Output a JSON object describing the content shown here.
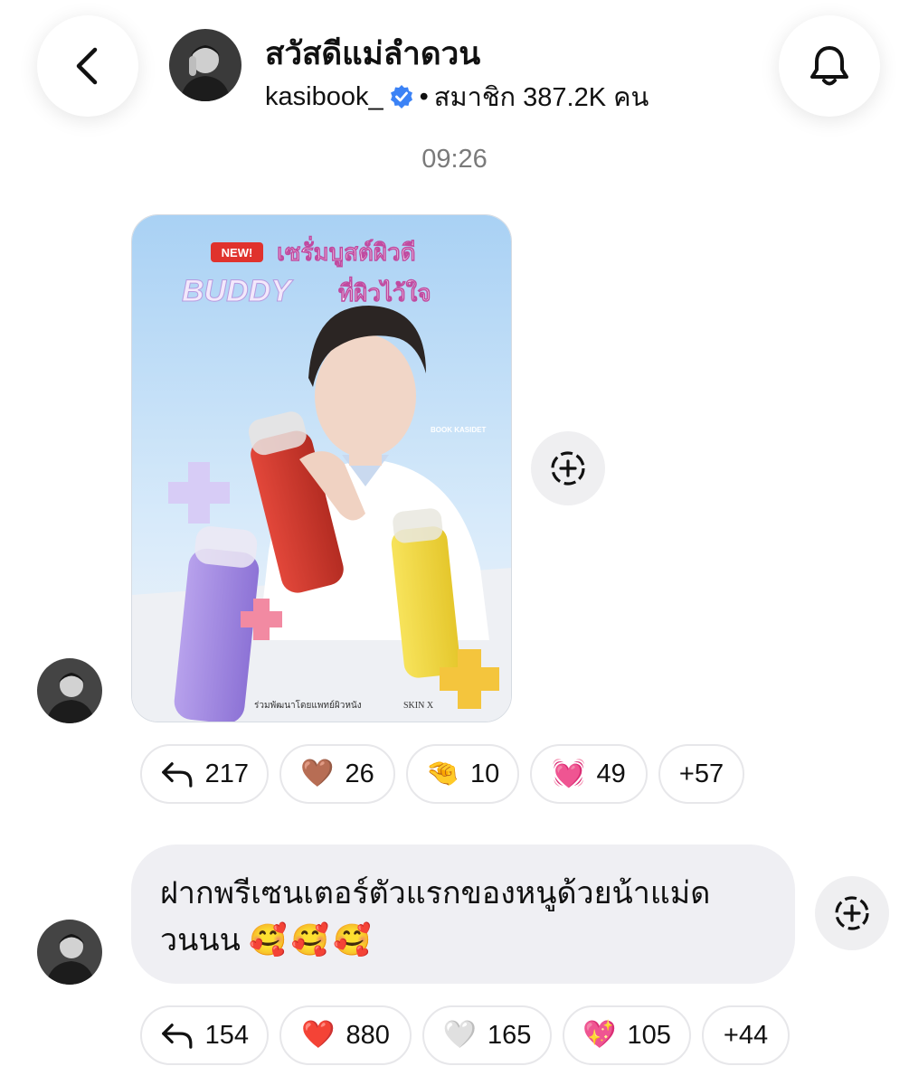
{
  "header": {
    "title": "สวัสดีแม่ลำดวน",
    "username": "kasibook_",
    "separator": "•",
    "members": "สมาชิก 387.2K คน"
  },
  "timestamp": "09:26",
  "post": {
    "image_description_icon": "product-ad-image",
    "reactions": [
      {
        "icon": "reply-icon",
        "count": "217"
      },
      {
        "icon": "brown-heart",
        "emoji": "🤎",
        "count": "26"
      },
      {
        "icon": "pinching-hand",
        "emoji": "🤏",
        "count": "10"
      },
      {
        "icon": "beating-heart",
        "emoji": "💓",
        "count": "49"
      },
      {
        "more": "+57"
      }
    ],
    "ad": {
      "badge": "NEW!",
      "headline1": "เซรั่มบูสต์ผิวดี",
      "headline2a": "BUDDY",
      "headline2b": "ที่ผิวไว้ใจ",
      "name": "BOOK KASIDET",
      "footer": "ร่วมพัฒนาโดยแพทย์ผิวหนัง",
      "brand": "SKIN X"
    }
  },
  "message": {
    "text": "ฝากพรีเซนเตอร์ตัวแรกของหนูด้วยน้าแม่ดวนนน",
    "emojis": "🥰🥰🥰",
    "reactions": [
      {
        "icon": "reply-icon",
        "count": "154"
      },
      {
        "icon": "red-heart",
        "emoji": "❤️",
        "count": "880"
      },
      {
        "icon": "white-heart",
        "emoji": "🤍",
        "count": "165"
      },
      {
        "icon": "sparkling-heart",
        "emoji": "💖",
        "count": "105"
      },
      {
        "more": "+44"
      }
    ]
  },
  "colors": {
    "verified": "#3b82f6",
    "bubble": "#efeff3",
    "chip_border": "#e7e7ea"
  }
}
